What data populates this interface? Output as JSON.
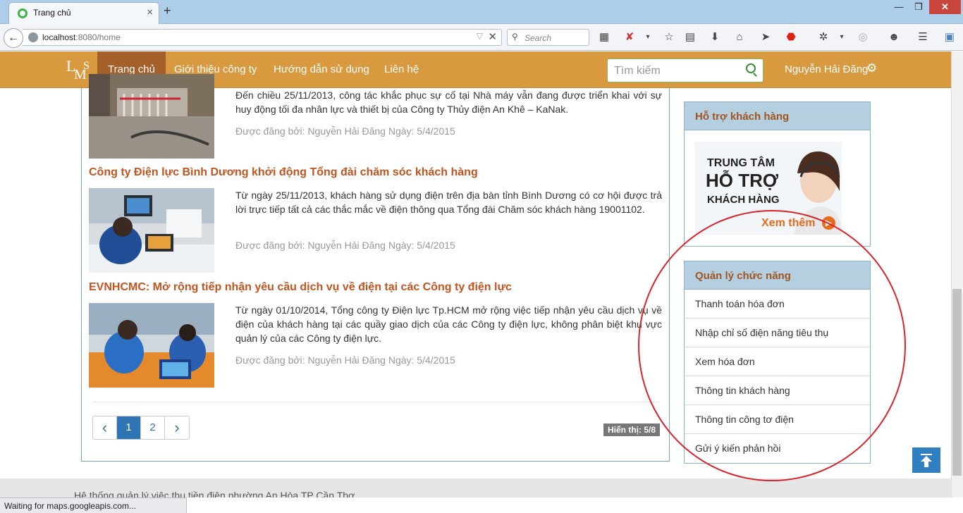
{
  "browser": {
    "tab_title": "Trang chủ",
    "url_host": "localhost",
    "url_port_path": ":8080/home",
    "search_placeholder": "Search",
    "status_text": "Waiting for maps.googleapis.com..."
  },
  "site": {
    "logo": {
      "l": "L",
      "m": "M",
      "s": "S"
    },
    "nav": [
      "Trang chủ",
      "Giới thiệu công ty",
      "Hướng dẫn sử dụng",
      "Liên hệ"
    ],
    "search_placeholder": "Tìm kiếm",
    "user_name": "Nguyễn Hải Đăng"
  },
  "posts": [
    {
      "title": "",
      "body": "Đến chiều 25/11/2013, công tác khắc phục sự cố tại Nhà máy vẫn đang được triển khai với sự huy động tối đa nhân lực và thiết bị của Công ty Thủy điện An Khê – KaNak.",
      "meta": "Được đăng bởi: Nguyễn Hải Đăng Ngày: 5/4/2015"
    },
    {
      "title": "Công ty Điện lực Bình Dương khởi động Tổng đài chăm sóc khách hàng",
      "body": "Từ ngày 25/11/2013, khách hàng sử dụng điện trên địa bàn tỉnh Bình Dương có cơ hội được trả lời trực tiếp tất cả các thắc mắc về điện thông qua Tổng đài Chăm sóc khách hàng 19001102.",
      "meta": "Được đăng bởi: Nguyễn Hải Đăng Ngày: 5/4/2015"
    },
    {
      "title": "EVNHCMC: Mở rộng tiếp nhận yêu cầu dịch vụ về điện tại các Công ty điện lực",
      "body": "Từ ngày 01/10/2014, Tổng công ty Điện lực Tp.HCM mở rộng việc tiếp nhận yêu cầu dịch vụ về điện của khách hàng tại các quầy giao dịch của các Công ty điện lực, không phân biệt khu vực quản lý của các Công ty điện lực.",
      "meta": "Được đăng bởi: Nguyễn Hải Đăng Ngày: 5/4/2015"
    }
  ],
  "pagination": {
    "prev": "‹",
    "pages": [
      "1",
      "2"
    ],
    "next": "›",
    "current": "1",
    "count_label": "Hiển thị: 5/8"
  },
  "support": {
    "title": "Hỗ trợ khách hàng",
    "promo_line1": "TRUNG TÂM",
    "promo_line2": "HỖ TRỢ",
    "promo_line3": "KHÁCH HÀNG",
    "promo_link": "Xem thêm"
  },
  "functions": {
    "title": "Quản lý chức năng",
    "items": [
      "Thanh toán hóa đơn",
      "Nhập chỉ số điện năng tiêu thụ",
      "Xem hóa đơn",
      "Thông tin khách hàng",
      "Thông tin công tơ điện",
      "Gửi ý kiến phản hồi"
    ]
  },
  "footer_text": "Hệ thống quản lý việc thu tiền điện phường An Hòa TP Cần Thơ",
  "colors": {
    "nav_bg": "#d9993f",
    "nav_active": "#a5602a",
    "post_title": "#c2541f",
    "panel_header": "#b3cfe0",
    "annotation_circle": "#d9232b"
  }
}
